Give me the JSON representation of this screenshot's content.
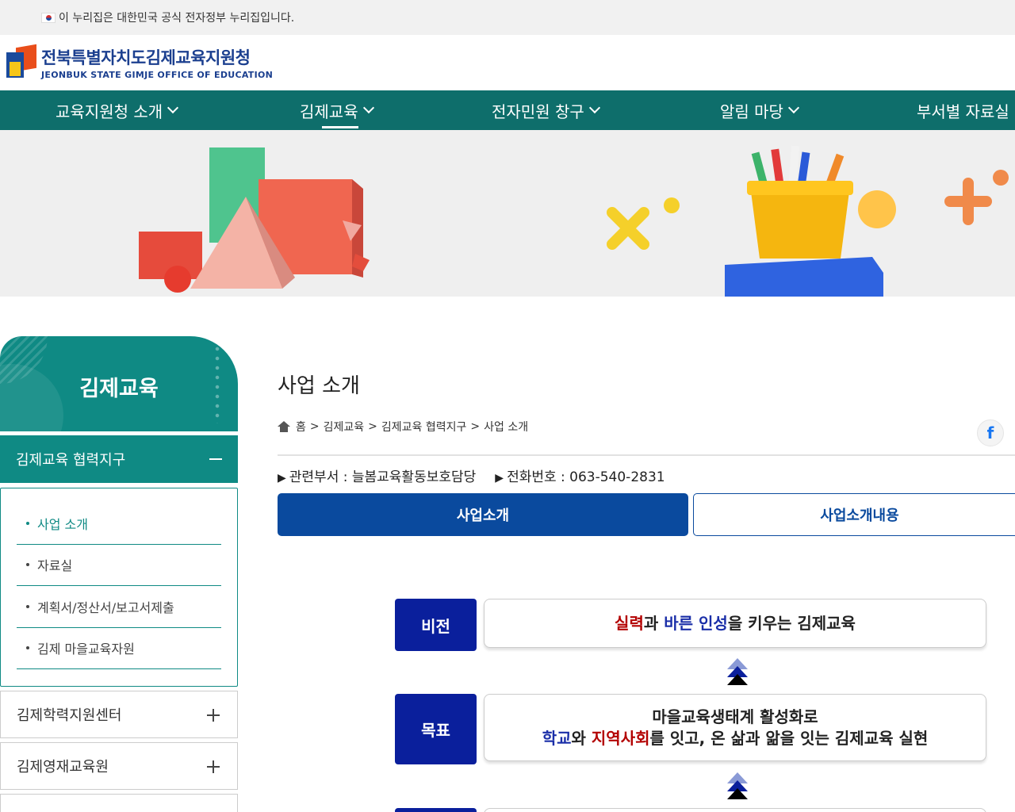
{
  "gov_banner": {
    "text": "이 누리집은 대한민국 공식 전자정부 누리집입니다."
  },
  "header": {
    "logo_ko": "전북특별자치도김제교육지원청",
    "logo_en": "JEONBUK STATE GIMJE OFFICE OF EDUCATION"
  },
  "nav": {
    "items": [
      {
        "label": "교육지원청 소개"
      },
      {
        "label": "김제교육"
      },
      {
        "label": "전자민원 창구"
      },
      {
        "label": "알림 마당"
      },
      {
        "label": "부서별 자료실"
      }
    ]
  },
  "sidebar": {
    "title": "김제교육",
    "section": "김제교육 협력지구",
    "items": [
      {
        "label": "사업 소개"
      },
      {
        "label": "자료실"
      },
      {
        "label": "계획서/정산서/보고서제출"
      },
      {
        "label": "김제 마을교육자원"
      }
    ],
    "collapsed": [
      {
        "label": "김제학력지원센터"
      },
      {
        "label": "김제영재교육원"
      }
    ]
  },
  "main": {
    "title": "사업 소개",
    "breadcrumb": {
      "home": "홈",
      "sep": ">",
      "items": [
        "김제교육",
        "김제교육 협력지구",
        "사업 소개"
      ]
    },
    "share_facebook": "f",
    "dept_label": "관련부서 : 늘봄교육활동보호담당",
    "phone_label": "전화번호 : 063-540-2831",
    "tabs": [
      {
        "label": "사업소개"
      },
      {
        "label": "사업소개내용"
      }
    ],
    "vision": {
      "label": "비전",
      "part1": "실력",
      "part2": "과 ",
      "part3": "바른 인성",
      "part4": "을 키우는 김제교육"
    },
    "goal": {
      "label": "목표",
      "line1": "마을교육생태계 활성화로",
      "part1": "학교",
      "part2": "와 ",
      "part3": "지역사회",
      "part4": "를 잇고, 온 삶과 앎을 잇는 김제교육 실현"
    }
  },
  "colors": {
    "teal": "#0f8a84",
    "nav_teal": "#0e6e6b",
    "tab_blue": "#0a4a9e",
    "label_navy": "#0a1f9c",
    "accent_red": "#b30000"
  }
}
